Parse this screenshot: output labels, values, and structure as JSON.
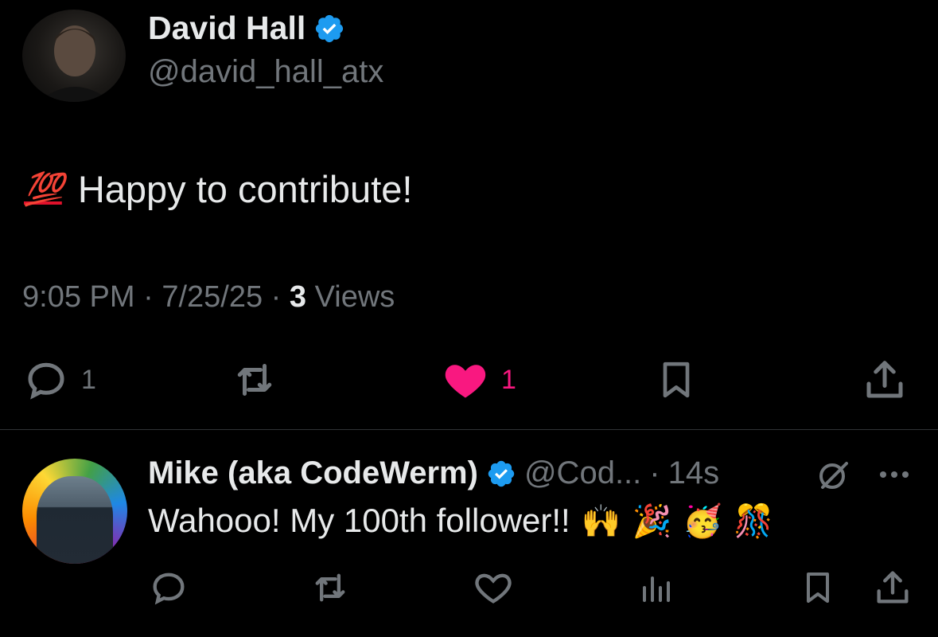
{
  "main_post": {
    "author_name": "David Hall",
    "handle": "@david_hall_atx",
    "emoji": "💯",
    "text": "Happy to contribute!",
    "time": "9:05 PM",
    "date": "7/25/25",
    "sep": "·",
    "views_count": "3",
    "views_label": "Views",
    "actions": {
      "reply_count": "1",
      "like_count": "1"
    }
  },
  "reply": {
    "author_name": "Mike (aka CodeWerm)",
    "handle": "@Cod...",
    "sep": "·",
    "age": "14s",
    "text": "Wahooo! My 100th follower!!",
    "emojis": [
      "🙌",
      "🎉",
      "🥳",
      "🎊"
    ]
  },
  "colors": {
    "background": "#000000",
    "primary_text": "#e7e9ea",
    "secondary_text": "#71767b",
    "verified_badge": "#1d9bf0",
    "like_active": "#f91880",
    "divider": "#2f3336"
  },
  "icons": [
    "verified-badge-icon",
    "reply-icon",
    "repost-icon",
    "like-icon",
    "bookmark-icon",
    "share-icon",
    "grok-icon",
    "more-icon",
    "analytics-icon"
  ]
}
